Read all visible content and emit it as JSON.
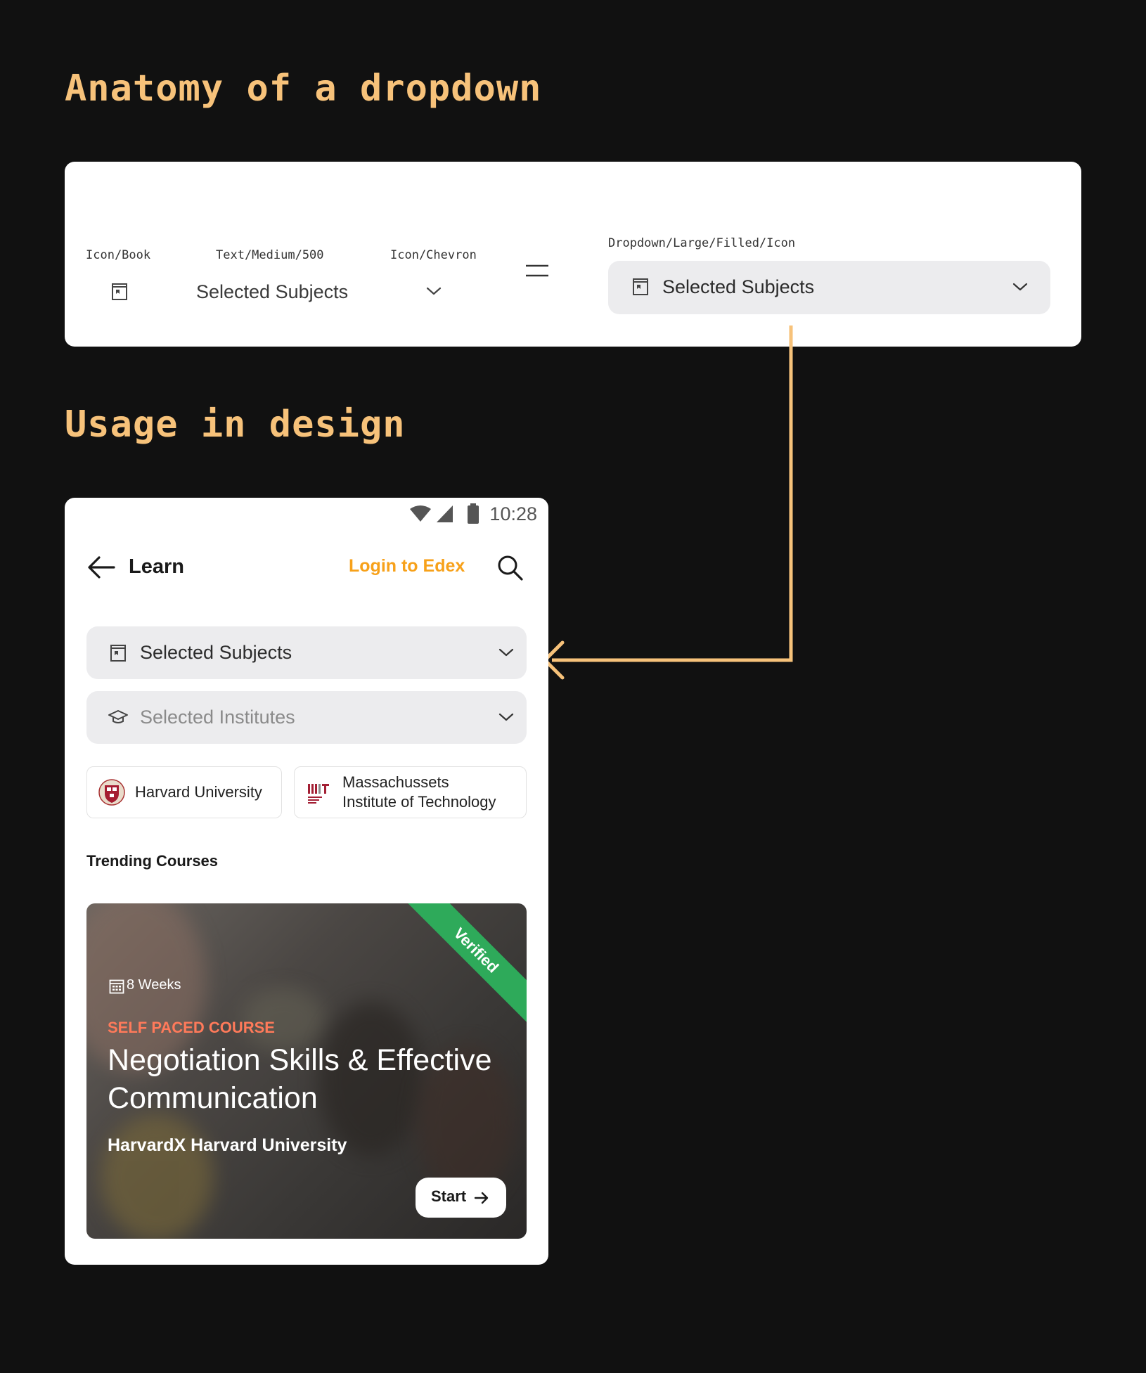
{
  "headings": {
    "anatomy": "Anatomy of a dropdown",
    "usage": "Usage in design"
  },
  "anatomy": {
    "labels": {
      "icon_book": "Icon/Book",
      "text": "Text/Medium/500",
      "icon_chevron": "Icon/Chevron",
      "dropdown": "Dropdown/Large/Filled/Icon"
    },
    "part_text": "Selected Subjects",
    "equals": "=",
    "dropdown_text": "Selected Subjects"
  },
  "phone": {
    "status": {
      "time": "10:28"
    },
    "header": {
      "title": "Learn",
      "login": "Login to Edex"
    },
    "dropdowns": [
      {
        "label": "Selected Subjects",
        "icon": "book-icon"
      },
      {
        "label": "Selected Institutes",
        "icon": "graduation-cap-icon"
      }
    ],
    "institutes": [
      {
        "name": "Harvard University",
        "logo": "harvard-crest-icon"
      },
      {
        "line1": "Massachussets",
        "line2": "Institute of Technology",
        "logo": "mit-logo-icon"
      }
    ],
    "section_title": "Trending Courses",
    "course": {
      "badge": "Verified",
      "duration": "8 Weeks",
      "type": "SELF PACED COURSE",
      "title": "Negotiation Skills & Effective Communication",
      "provider": "HarvardX Harvard University",
      "cta": "Start"
    }
  },
  "colors": {
    "background": "#111111",
    "accent": "#f7c27a",
    "link": "#f7a11a",
    "verified": "#2eaa5a",
    "course_type": "#ff7a5a"
  }
}
